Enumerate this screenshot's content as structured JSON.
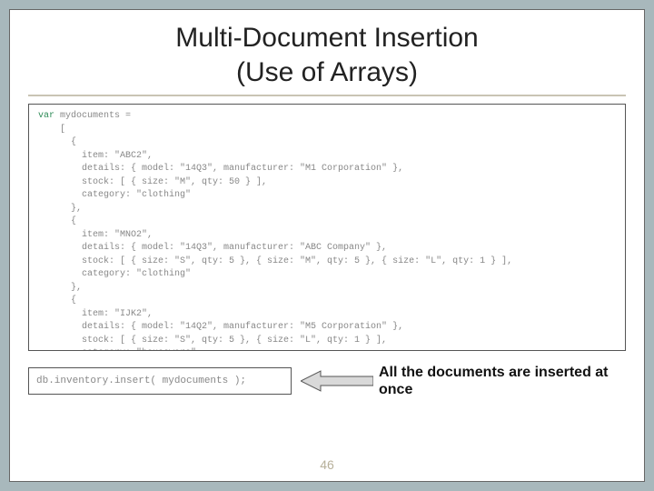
{
  "title_line1": "Multi-Document Insertion",
  "title_line2": "(Use of Arrays)",
  "code": {
    "keyword": "var",
    "rest_line1": " mydocuments =",
    "body": "    [\n      {\n        item: \"ABC2\",\n        details: { model: \"14Q3\", manufacturer: \"M1 Corporation\" },\n        stock: [ { size: \"M\", qty: 50 } ],\n        category: \"clothing\"\n      },\n      {\n        item: \"MNO2\",\n        details: { model: \"14Q3\", manufacturer: \"ABC Company\" },\n        stock: [ { size: \"S\", qty: 5 }, { size: \"M\", qty: 5 }, { size: \"L\", qty: 1 } ],\n        category: \"clothing\"\n      },\n      {\n        item: \"IJK2\",\n        details: { model: \"14Q2\", manufacturer: \"M5 Corporation\" },\n        stock: [ { size: \"S\", qty: 5 }, { size: \"L\", qty: 1 } ],\n        category: \"houseware\"\n      }\n    ];"
  },
  "insert_statement": "db.inventory.insert( mydocuments );",
  "caption": "All the documents are inserted at once",
  "page_number": "46"
}
